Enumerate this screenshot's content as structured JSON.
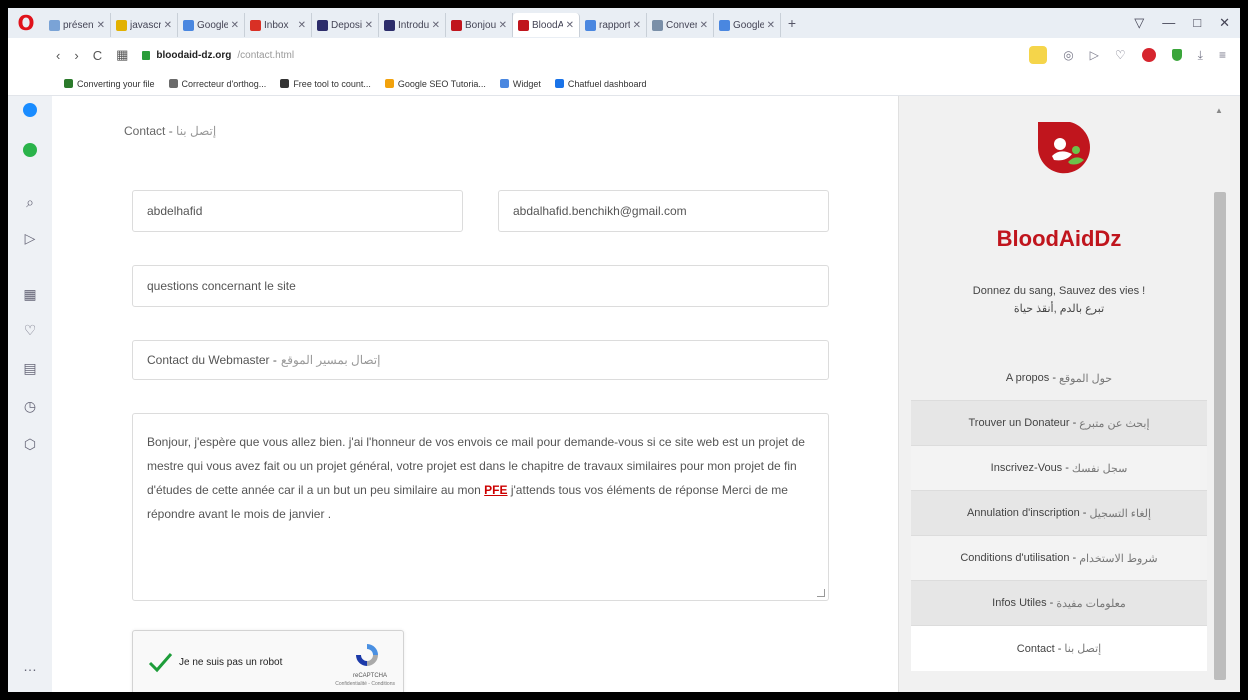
{
  "browser": {
    "tabs": [
      {
        "title": "présent",
        "color": "#7aa3d6"
      },
      {
        "title": "javascri",
        "color": "#e2b100"
      },
      {
        "title": "Google",
        "color": "#4a87e0"
      },
      {
        "title": "Inbox",
        "color": "#d93025"
      },
      {
        "title": "Deposi",
        "color": "#2d2d6b"
      },
      {
        "title": "Introdu",
        "color": "#2d2d6b"
      },
      {
        "title": "Bonjour",
        "color": "#c0151d"
      },
      {
        "title": "BloodA",
        "color": "#c0151d",
        "active": true
      },
      {
        "title": "rapport",
        "color": "#4a87e0"
      },
      {
        "title": "Convert",
        "color": "#7a8fa8"
      },
      {
        "title": "Google",
        "color": "#4a87e0"
      }
    ],
    "url_host": "bloodaid-dz.org",
    "url_path": "/contact.html"
  },
  "bookmarks": [
    {
      "label": "Converting your file",
      "color": "#2b7a2b"
    },
    {
      "label": "Correcteur d'orthog...",
      "color": "#6a6a6a"
    },
    {
      "label": "Free tool to count...",
      "color": "#333333"
    },
    {
      "label": "Google SEO Tutoria...",
      "color": "#f2a20c"
    },
    {
      "label": "Widget",
      "color": "#4a87e0"
    },
    {
      "label": "Chatfuel dashboard",
      "color": "#1a73e8"
    }
  ],
  "page": {
    "breadcrumb_fr": "Contact - ",
    "breadcrumb_ar": "إتصل بنا",
    "form": {
      "name": "abdelhafid",
      "email": "abdalhafid.benchikh@gmail.com",
      "subject": "questions concernant le site",
      "recipient_fr": "Contact du Webmaster - ",
      "recipient_ar": "إتصال بمسير الموقع",
      "message_part1": "Bonjour, j'espère que vous allez bien. j'ai l'honneur de vos envois ce mail pour demande-vous si ce site web est un projet de mestre qui vous avez fait ou un projet général, votre projet est dans le chapitre de travaux similaires pour mon projet de fin d'études de cette année car il a un but un peu similaire au mon ",
      "message_pfe": "PFE",
      "message_part2": " j'attends tous vos éléments de réponse Merci de me répondre avant le mois de janvier ."
    },
    "captcha": {
      "label": "Je ne suis pas un robot",
      "brand": "reCAPTCHA",
      "links": "Confidentialité - Conditions"
    }
  },
  "panel": {
    "brand": "BloodAidDz",
    "tagline_fr": "Donnez du sang, Sauvez des vies !",
    "tagline_ar": "تبرع بالدم ,أنقذ حياة",
    "menu": [
      {
        "fr": "A propos - ",
        "ar": "حول الموقع"
      },
      {
        "fr": "Trouver un Donateur - ",
        "ar": "إبحث عن متبرع"
      },
      {
        "fr": "Inscrivez-Vous - ",
        "ar": "سجل نفسك"
      },
      {
        "fr": "Annulation d'inscription - ",
        "ar": "إلغاء التسجيل"
      },
      {
        "fr": "Conditions d'utilisation - ",
        "ar": "شروط الاستخدام"
      },
      {
        "fr": "Infos Utiles - ",
        "ar": "معلومات مفيدة"
      },
      {
        "fr": "Contact - ",
        "ar": "إتصل بنا"
      }
    ]
  },
  "colors": {
    "brand_red": "#c0151d",
    "opera_red": "#e0121b"
  }
}
